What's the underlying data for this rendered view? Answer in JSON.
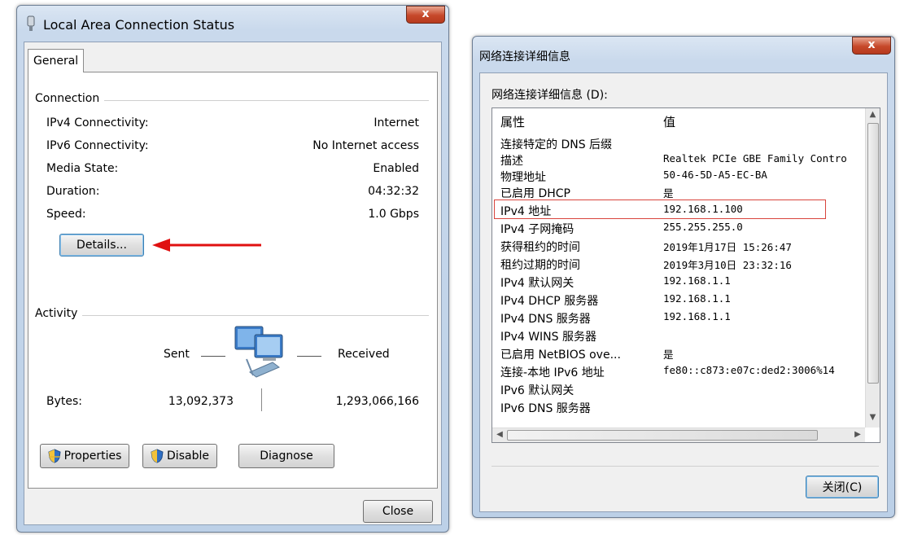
{
  "left_window": {
    "title": "Local Area Connection Status",
    "close_glyph": "x",
    "tab": "General",
    "connection": {
      "group_label": "Connection",
      "rows": [
        {
          "label": "IPv4 Connectivity:",
          "value": "Internet"
        },
        {
          "label": "IPv6 Connectivity:",
          "value": "No Internet access"
        },
        {
          "label": "Media State:",
          "value": "Enabled"
        },
        {
          "label": "Duration:",
          "value": "04:32:32"
        },
        {
          "label": "Speed:",
          "value": "1.0 Gbps"
        }
      ]
    },
    "details_button": "Details...",
    "activity": {
      "group_label": "Activity",
      "sent_label": "Sent",
      "received_label": "Received",
      "bytes_label": "Bytes:",
      "bytes_sent": "13,092,373",
      "bytes_received": "1,293,066,166"
    },
    "buttons": {
      "properties": "Properties",
      "disable": "Disable",
      "diagnose": "Diagnose",
      "close": "Close"
    }
  },
  "right_window": {
    "title": "网络连接详细信息",
    "close_glyph": "x",
    "list_caption": "网络连接详细信息 (D):",
    "col_property": "属性",
    "col_value": "值",
    "rows": [
      {
        "label": "连接特定的 DNS 后缀",
        "value": ""
      },
      {
        "label": "描述",
        "value": "Realtek PCIe GBE Family Contro"
      },
      {
        "label": "物理地址",
        "value": "50-46-5D-A5-EC-BA"
      },
      {
        "label": "已启用 DHCP",
        "value": "是"
      },
      {
        "label": "IPv4 地址",
        "value": "192.168.1.100"
      },
      {
        "label": "IPv4 子网掩码",
        "value": "255.255.255.0"
      },
      {
        "label": "获得租约的时间",
        "value": "2019年1月17日 15:26:47"
      },
      {
        "label": "租约过期的时间",
        "value": "2019年3月10日 23:32:16"
      },
      {
        "label": "IPv4 默认网关",
        "value": "192.168.1.1"
      },
      {
        "label": "IPv4 DHCP 服务器",
        "value": "192.168.1.1"
      },
      {
        "label": "IPv4 DNS 服务器",
        "value": "192.168.1.1"
      },
      {
        "label": "IPv4 WINS 服务器",
        "value": ""
      },
      {
        "label": "已启用 NetBIOS ove...",
        "value": "是"
      },
      {
        "label": "连接-本地 IPv6 地址",
        "value": "fe80::c873:e07c:ded2:3006%14"
      },
      {
        "label": "IPv6 默认网关",
        "value": ""
      },
      {
        "label": "IPv6 DNS 服务器",
        "value": ""
      }
    ],
    "close_button": "关闭(C)"
  },
  "colors": {
    "arrow": "#e01010",
    "highlight_box": "#d8443c",
    "accent": "#3c7fb1"
  }
}
